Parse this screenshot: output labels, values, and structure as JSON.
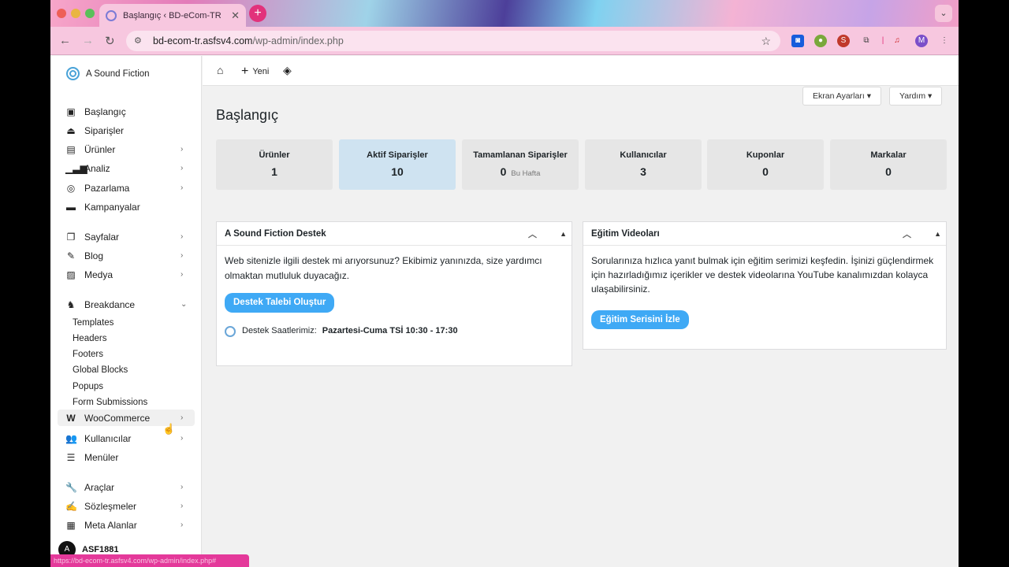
{
  "browser": {
    "tab_title": "Başlangıç ‹ BD-eCom-TR",
    "url_host": "bd-ecom-tr.asfsv4.com",
    "url_path": "/wp-admin/index.php",
    "status_url": "https://bd-ecom-tr.asfsv4.com/wp-admin/index.php#"
  },
  "sidebar": {
    "brand": "A Sound Fiction",
    "items": [
      {
        "label": "Başlangıç",
        "icon": "dashboard-icon",
        "arrow": false
      },
      {
        "label": "Siparişler",
        "icon": "inbox-icon",
        "arrow": false
      },
      {
        "label": "Ürünler",
        "icon": "archive-icon",
        "arrow": true
      },
      {
        "label": "Analiz",
        "icon": "bar-chart-icon",
        "arrow": true
      },
      {
        "label": "Pazarlama",
        "icon": "target-icon",
        "arrow": true
      },
      {
        "label": "Kampanyalar",
        "icon": "card-icon",
        "arrow": false
      },
      {
        "label": "Sayfalar",
        "icon": "pages-icon",
        "arrow": true
      },
      {
        "label": "Blog",
        "icon": "edit-icon",
        "arrow": true
      },
      {
        "label": "Medya",
        "icon": "image-icon",
        "arrow": true
      },
      {
        "label": "Breakdance",
        "icon": "breakdance-icon",
        "arrow": true
      },
      {
        "label": "WooCommerce",
        "icon": "woo-icon",
        "arrow": true
      },
      {
        "label": "Kullanıcılar",
        "icon": "users-icon",
        "arrow": true
      },
      {
        "label": "Menüler",
        "icon": "list-icon",
        "arrow": false
      },
      {
        "label": "Araçlar",
        "icon": "wrench-icon",
        "arrow": true
      },
      {
        "label": "Sözleşmeler",
        "icon": "contract-icon",
        "arrow": true
      },
      {
        "label": "Meta Alanlar",
        "icon": "table-icon",
        "arrow": true
      }
    ],
    "breakdance_sub": [
      "Templates",
      "Headers",
      "Footers",
      "Global Blocks",
      "Popups",
      "Form Submissions"
    ],
    "user_name": "ASF1881",
    "user_initial": "A"
  },
  "adminbar": {
    "new_label": "Yeni"
  },
  "main": {
    "screen_options": "Ekran Ayarları",
    "help": "Yardım",
    "title": "Başlangıç",
    "stats": [
      {
        "label": "Ürünler",
        "value": "1",
        "sub": ""
      },
      {
        "label": "Aktif Siparişler",
        "value": "10",
        "sub": ""
      },
      {
        "label": "Tamamlanan Siparişler",
        "value": "0",
        "sub": "Bu Hafta"
      },
      {
        "label": "Kullanıcılar",
        "value": "3",
        "sub": ""
      },
      {
        "label": "Kuponlar",
        "value": "0",
        "sub": ""
      },
      {
        "label": "Markalar",
        "value": "0",
        "sub": ""
      }
    ],
    "support": {
      "title": "A Sound Fiction Destek",
      "text": "Web sitenizle ilgili destek mi arıyorsunuz? Ekibimiz yanınızda, size yardımcı olmaktan mutluluk duyacağız.",
      "button": "Destek Talebi Oluştur",
      "hours_label": "Destek Saatlerimiz:",
      "hours_value": "Pazartesi-Cuma TSİ 10:30 - 17:30"
    },
    "videos": {
      "title": "Eğitim Videoları",
      "text": "Sorularınıza hızlıca yanıt bulmak için eğitim serimizi keşfedin. İşinizi güçlendirmek için hazırladığımız içerikler ve destek videolarına YouTube kanalımızdan kolayca ulaşabilirsiniz.",
      "button": "Eğitim Serisini İzle"
    }
  }
}
